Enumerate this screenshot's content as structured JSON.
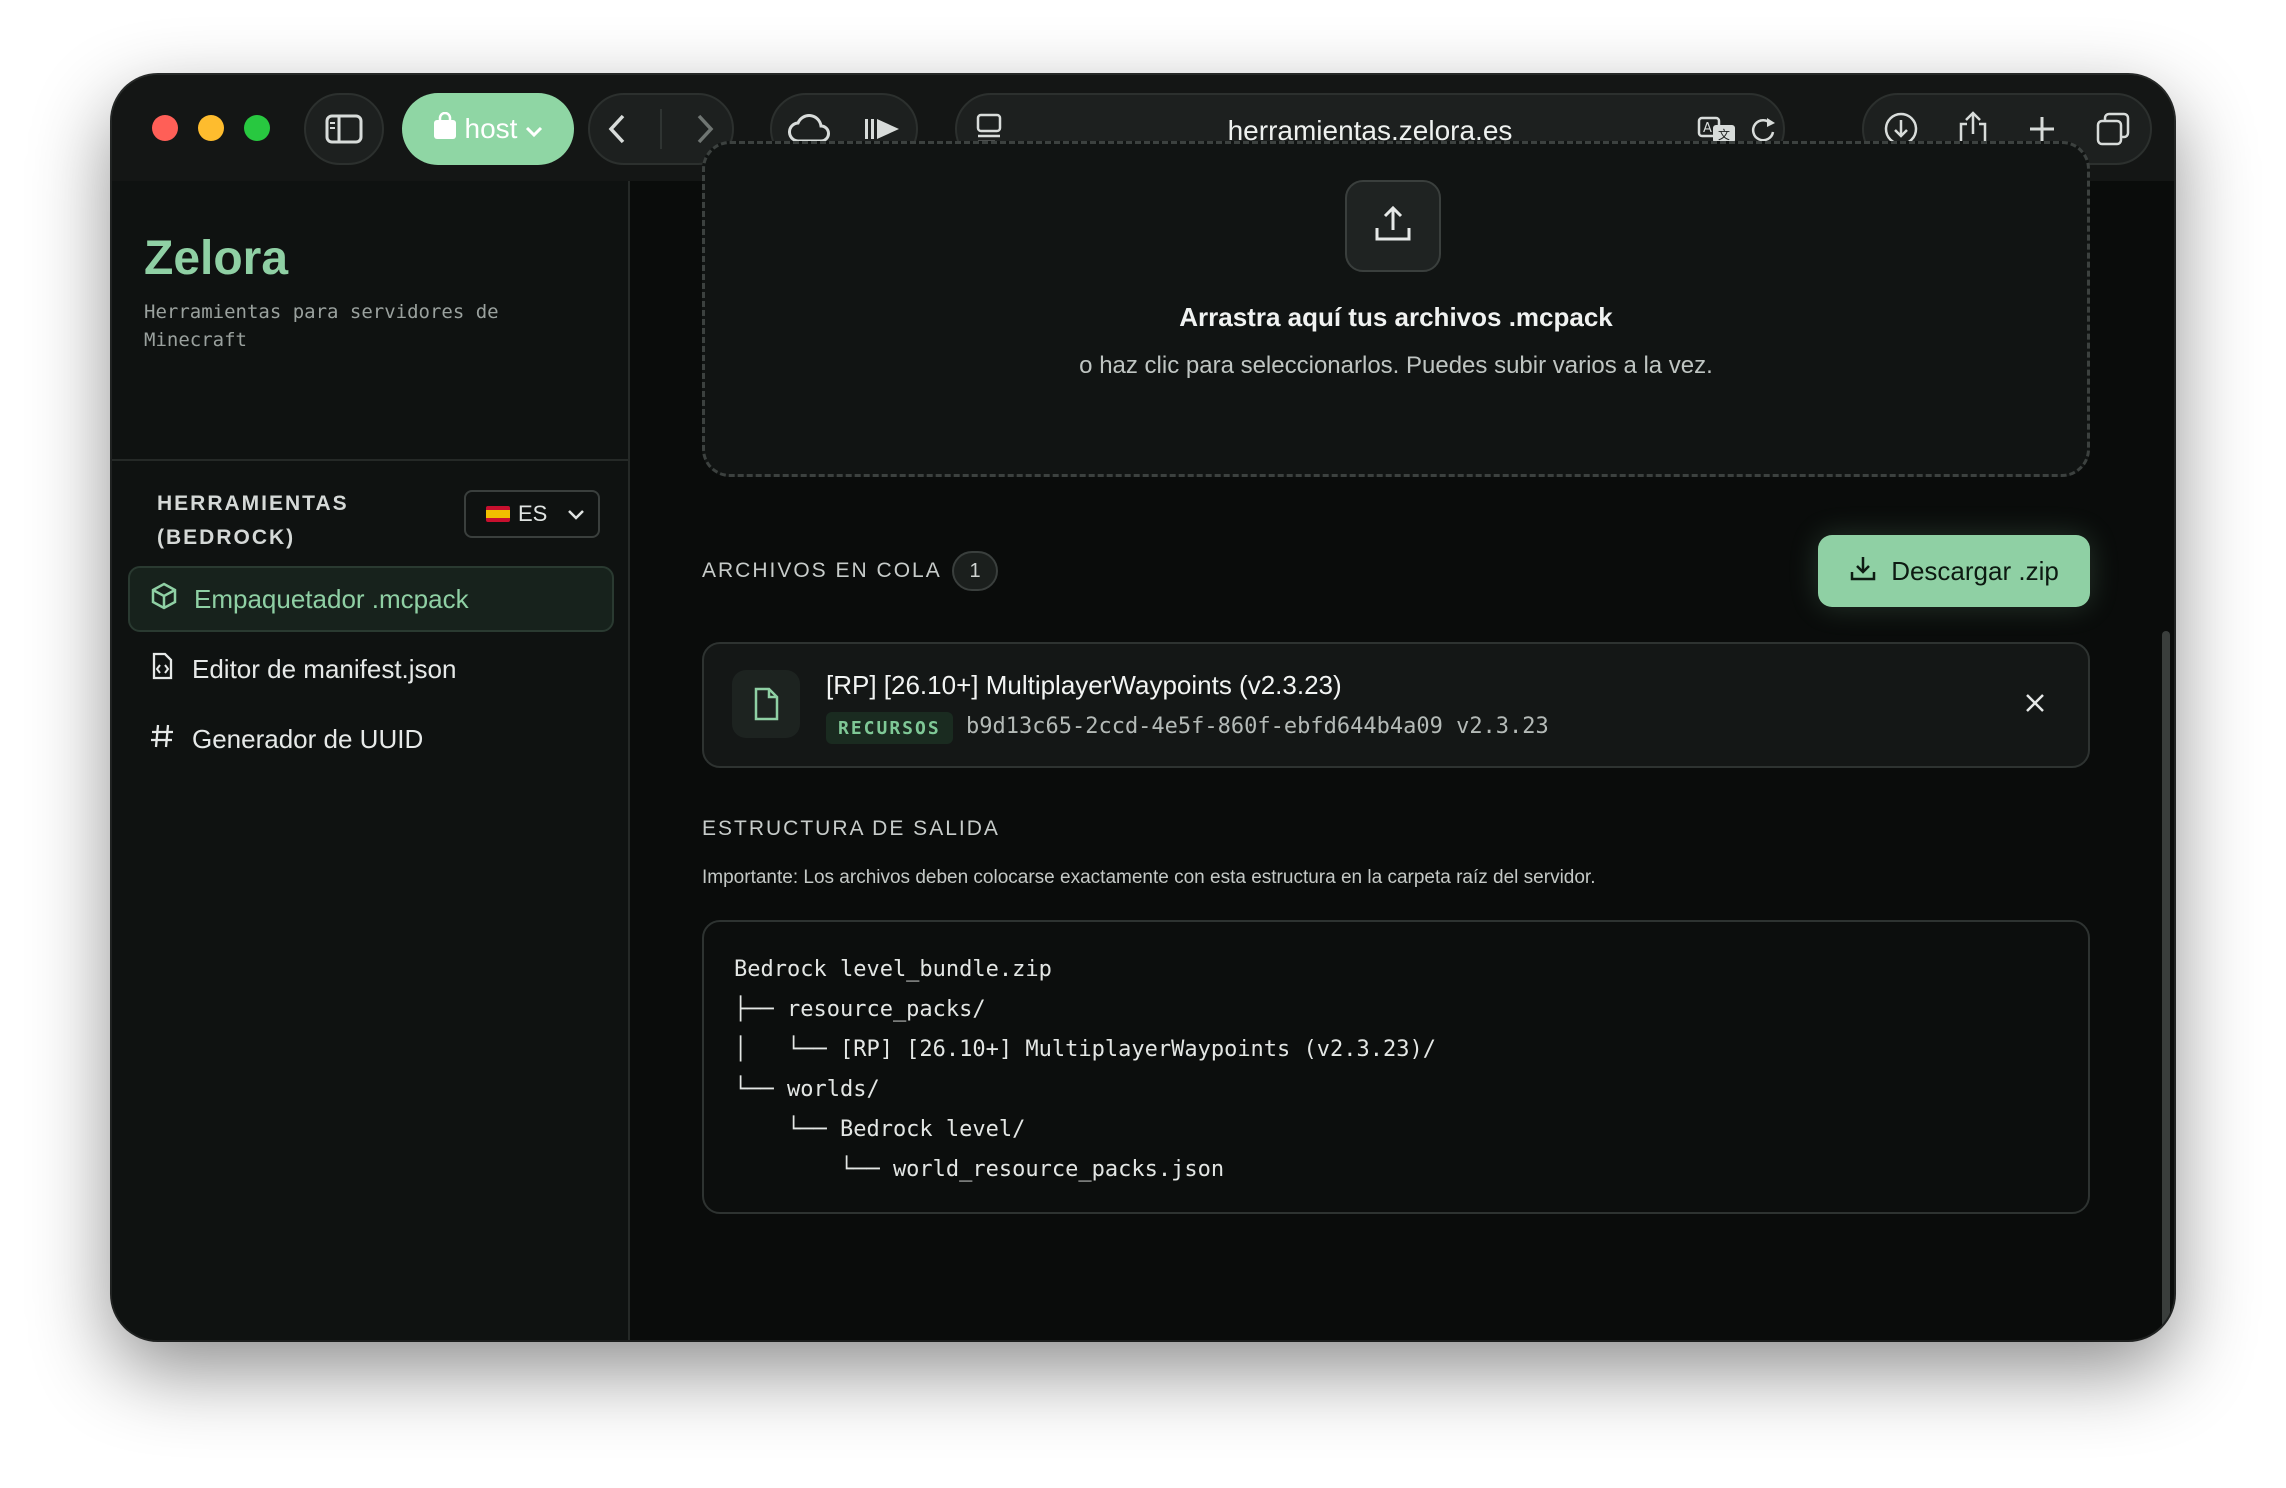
{
  "browser": {
    "host_label": "host",
    "url": "herramientas.zelora.es"
  },
  "sidebar": {
    "brand": "Zelora",
    "tagline": "Herramientas para servidores de Minecraft",
    "section_title": "HERRAMIENTAS (BEDROCK)",
    "language": "ES",
    "items": [
      {
        "label": "Empaquetador .mcpack",
        "icon": "package-icon",
        "active": true
      },
      {
        "label": "Editor de manifest.json",
        "icon": "file-code-icon",
        "active": false
      },
      {
        "label": "Generador de UUID",
        "icon": "hash-icon",
        "active": false
      }
    ]
  },
  "dropzone": {
    "title": "Arrastra aquí tus archivos .mcpack",
    "subtitle": "o haz clic para seleccionarlos. Puedes subir varios a la vez."
  },
  "queue": {
    "title": "ARCHIVOS EN COLA",
    "count": "1",
    "download_label": "Descargar .zip",
    "files": [
      {
        "name": "[RP] [26.10+] MultiplayerWaypoints (v2.3.23)",
        "type_badge": "RECURSOS",
        "meta": "b9d13c65-2ccd-4e5f-860f-ebfd644b4a09  v2.3.23"
      }
    ]
  },
  "output": {
    "title": "ESTRUCTURA DE SALIDA",
    "note": "Importante: Los archivos deben colocarse exactamente con esta estructura en la carpeta raíz del servidor.",
    "tree": [
      "Bedrock level_bundle.zip",
      "├── resource_packs/",
      "│   └── [RP] [26.10+] MultiplayerWaypoints (v2.3.23)/",
      "└── worlds/",
      "    └── Bedrock level/",
      "        └── world_resource_packs.json"
    ]
  },
  "colors": {
    "accent": "#8fd0a4",
    "background": "#0a0c0b",
    "traffic_red": "#ff5f57",
    "traffic_yellow": "#febc2e",
    "traffic_green": "#28c840"
  }
}
